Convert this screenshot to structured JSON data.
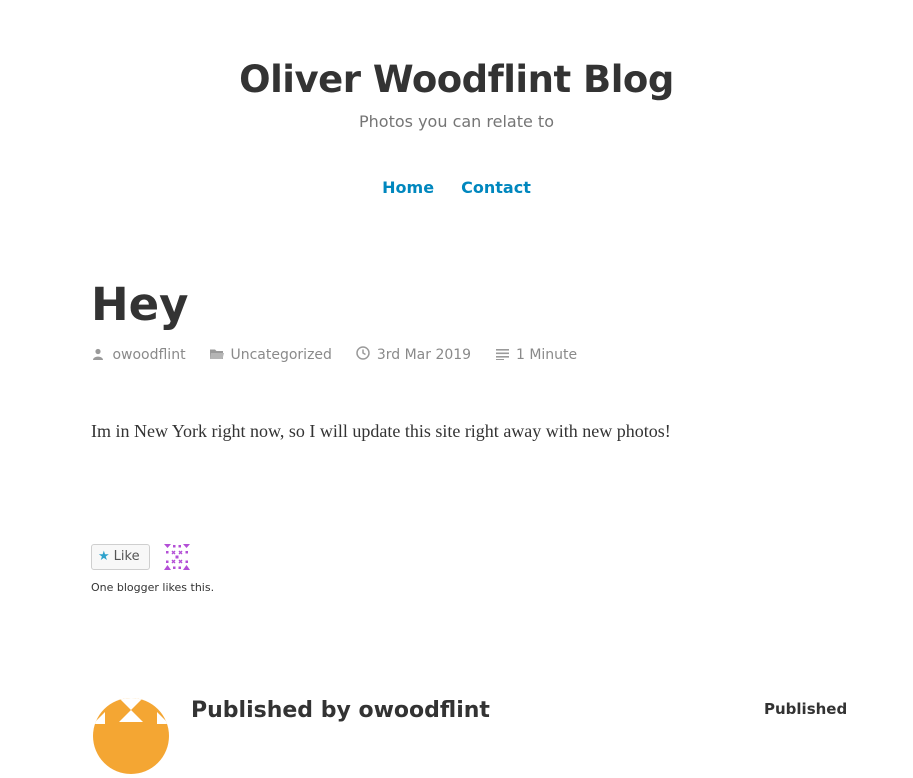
{
  "site": {
    "title": "Oliver Woodflint Blog",
    "tagline": "Photos you can relate to"
  },
  "nav": {
    "items": [
      {
        "label": "Home"
      },
      {
        "label": "Contact"
      }
    ]
  },
  "post": {
    "title": "Hey",
    "meta": {
      "author": "owoodflint",
      "category": "Uncategorized",
      "date": "3rd Mar 2019",
      "reading_time": "1 Minute"
    },
    "content": "Im in New York right now, so I will update this site right away with new photos!"
  },
  "likes": {
    "button_label": "Like",
    "summary": "One blogger likes this."
  },
  "author_box": {
    "prefix": "Published by",
    "name": "owoodflint",
    "published_label": "Published"
  },
  "colors": {
    "link": "#0087be",
    "meta": "#8a8a8a",
    "text": "#333333",
    "avatar_orange": "#f4a633",
    "identicon_purple": "#b34fd6"
  }
}
